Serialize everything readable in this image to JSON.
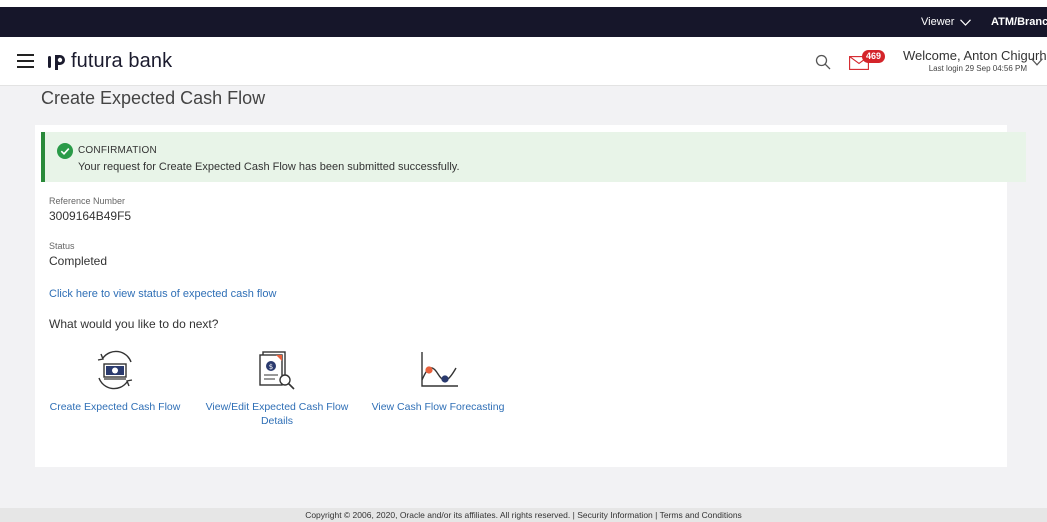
{
  "topbar": {
    "viewer_label": "Viewer",
    "branch_label": "ATM/Branch"
  },
  "header": {
    "brand_name": "futura bank",
    "mail_count": "469",
    "welcome_text": "Welcome, Anton Chigurh",
    "last_login": "Last login 29 Sep 04:56 PM"
  },
  "page": {
    "title": "Create Expected Cash Flow"
  },
  "confirmation": {
    "title": "CONFIRMATION",
    "message": "Your request for Create Expected Cash Flow has been submitted successfully."
  },
  "details": {
    "reference_label": "Reference Number",
    "reference_value": "3009164B49F5",
    "status_label": "Status",
    "status_value": "Completed"
  },
  "status_link": "Click here to view status of expected cash flow",
  "next_prompt": "What would you like to do next?",
  "actions": [
    {
      "label": "Create Expected Cash Flow",
      "icon": "cash-cycle-icon"
    },
    {
      "label": "View/Edit Expected Cash Flow Details",
      "icon": "document-search-icon"
    },
    {
      "label": "View Cash Flow Forecasting",
      "icon": "forecast-chart-icon"
    }
  ],
  "footer": {
    "copyright": "Copyright © 2006, 2020, Oracle and/or its affiliates. All rights reserved.",
    "separator": "|",
    "security_link": "Security Information",
    "terms_link": "Terms and Conditions"
  },
  "colors": {
    "topbar_bg": "#16162a",
    "link": "#2f6fb6",
    "success_bg": "#e8f4e8",
    "success_border": "#2a8a3a",
    "badge": "#d4242a",
    "accent_orange": "#e8603c",
    "accent_navy": "#2a3a6e"
  }
}
